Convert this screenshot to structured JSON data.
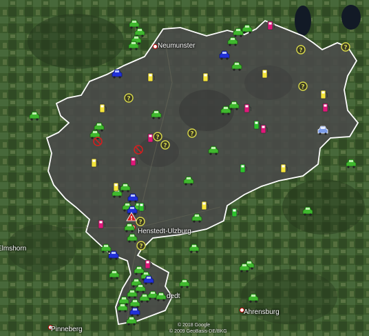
{
  "map": {
    "colors": {
      "region_fill": "#4a4a4a",
      "region_border": "#ffffff",
      "taxi_green": "#3fb82e",
      "bus_blue": "#2130d8",
      "fuel_yellow": "#f5e53a",
      "fuel_pink": "#e0177a",
      "fuel_green": "#2cc22c",
      "unknown_yellow": "#d8d84a",
      "noentry_red": "#d12020",
      "car_lightblue": "#7a9be8"
    },
    "places": {
      "neumunster": "Neumunster",
      "henstedt": "Henstedt-Ulzburg",
      "elmshorn": "Elmshorn",
      "norderstedt": "dedt",
      "ahrensburg": "Ahrensburg",
      "pinneberg": "Pinneberg"
    },
    "attribution": {
      "line1": "© 2018 Google",
      "line2": "© 2009 GeoBasis-DE/BKG"
    },
    "markers": [
      {
        "type": "taxi-green",
        "label": "taxi"
      },
      {
        "type": "bus-blue",
        "label": "bus"
      },
      {
        "type": "fuel-yellow",
        "label": "fuel station"
      },
      {
        "type": "fuel-pink",
        "label": "fuel station"
      },
      {
        "type": "fuel-green",
        "label": "fuel station"
      },
      {
        "type": "unknown",
        "label": "unknown"
      },
      {
        "type": "no-entry",
        "label": "no entry"
      },
      {
        "type": "warning",
        "label": "warning"
      },
      {
        "type": "car-blue",
        "label": "car"
      }
    ]
  }
}
